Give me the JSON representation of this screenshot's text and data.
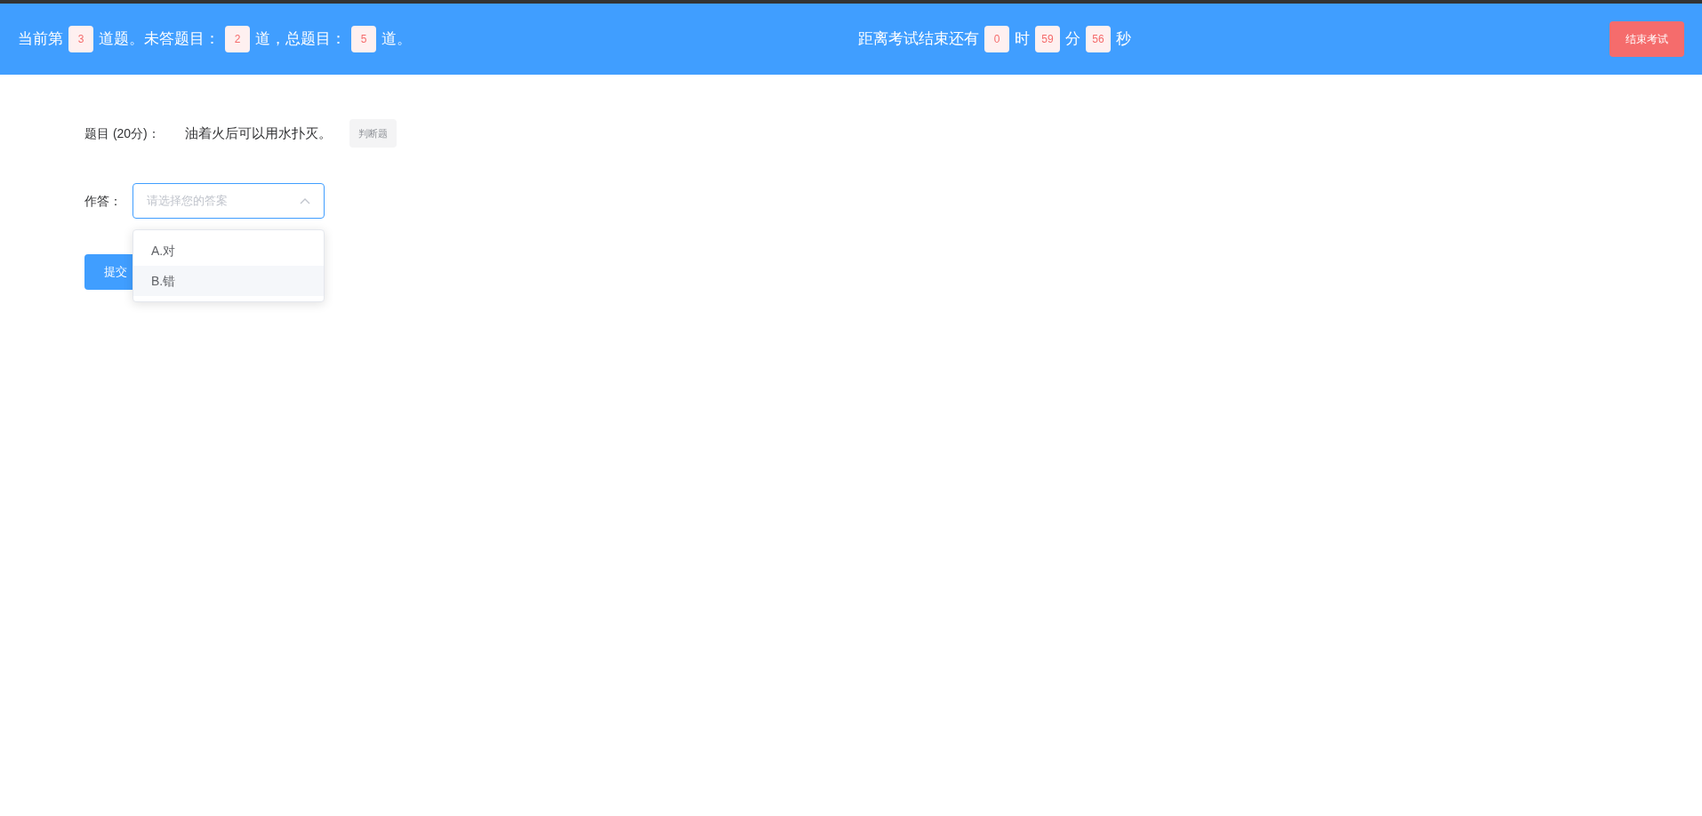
{
  "header": {
    "progress": [
      {
        "kind": "text",
        "text": "当前第"
      },
      {
        "kind": "badge",
        "text": "3"
      },
      {
        "kind": "text",
        "text": "道题。未答题目："
      },
      {
        "kind": "badge",
        "text": "2"
      },
      {
        "kind": "text",
        "text": "道，总题目："
      },
      {
        "kind": "badge",
        "text": "5"
      },
      {
        "kind": "text",
        "text": "道。"
      }
    ],
    "timer": [
      {
        "kind": "text",
        "text": "距离考试结束还有"
      },
      {
        "kind": "badge",
        "text": "0"
      },
      {
        "kind": "text",
        "text": "时"
      },
      {
        "kind": "badge",
        "text": "59"
      },
      {
        "kind": "text",
        "text": "分"
      },
      {
        "kind": "badge",
        "text": "56"
      },
      {
        "kind": "text",
        "text": "秒"
      }
    ],
    "end_button": "结束考试"
  },
  "question": {
    "label": "题目 (20分)：",
    "text": "油着火后可以用水扑灭。",
    "tag": "判断题"
  },
  "answer": {
    "label": "作答：",
    "placeholder": "请选择您的答案",
    "expanded": true,
    "options": [
      {
        "text": "A.对",
        "highlighted": false
      },
      {
        "text": "B.错",
        "highlighted": true
      }
    ]
  },
  "submit_button": "提交"
}
